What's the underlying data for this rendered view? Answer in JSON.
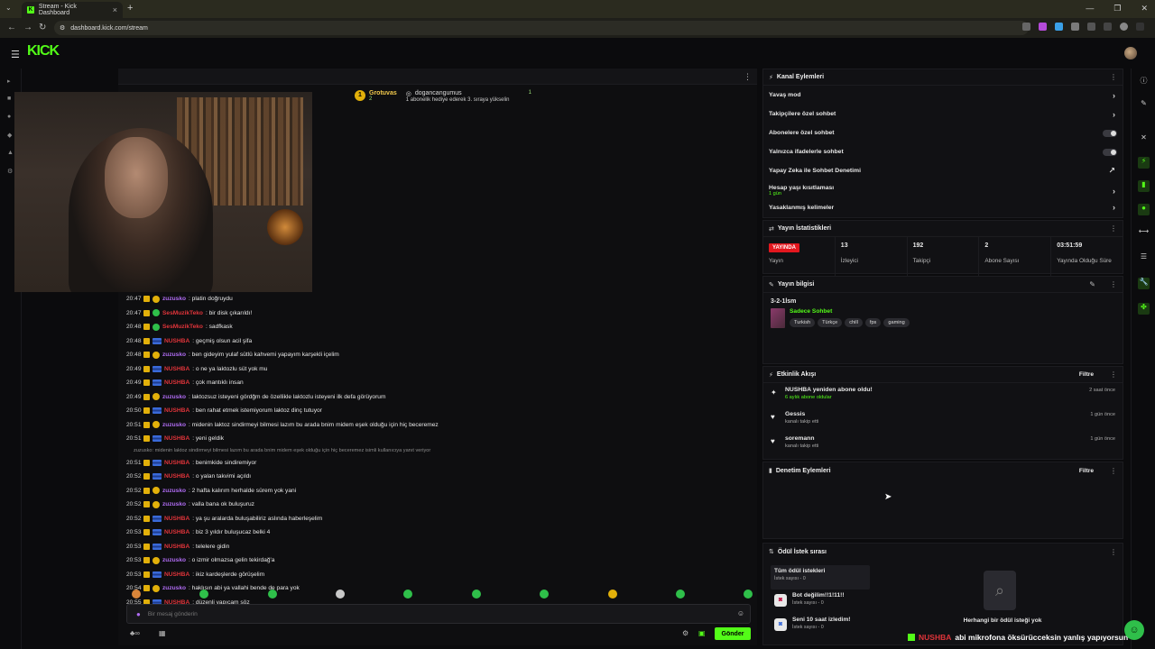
{
  "browser": {
    "tab_title": "Stream - Kick Dashboard",
    "url": "dashboard.kick.com/stream"
  },
  "app": {
    "logo": "KICK"
  },
  "pinned": {
    "gifter_name": "Grotuvas",
    "gifter_count": "2",
    "recipient_name": "dogancangumus",
    "recipient_count": "1",
    "gift_text": "1 abonelik hediye ederek 3. sıraya yükselin"
  },
  "messages": [
    {
      "time": "20:47",
      "user": "zuzusko",
      "color": "purple",
      "text": ": platin doğruydu"
    },
    {
      "time": "20:47",
      "user": "SesMuzikTeko",
      "color": "red",
      "text": ": bir disk çıkarıldı!"
    },
    {
      "time": "20:48",
      "user": "SesMuzikTeko",
      "color": "red",
      "text": ": sadfkask"
    },
    {
      "time": "20:48",
      "user": "NUSHBA",
      "color": "red",
      "text": ": geçmiş olsun acil şifa"
    },
    {
      "time": "20:48",
      "user": "zuzusko",
      "color": "purple",
      "text": ": ben gideyim yulaf sütlü kahvemi yapayım karşekli içelim"
    },
    {
      "time": "20:49",
      "user": "NUSHBA",
      "color": "red",
      "text": ": o ne ya laktozlu süt yok mu"
    },
    {
      "time": "20:49",
      "user": "NUSHBA",
      "color": "red",
      "text": ": çok mantıklı insan"
    },
    {
      "time": "20:49",
      "user": "zuzusko",
      "color": "purple",
      "text": ": laktozsuz isteyeni gördğm de özellikle laktozlu isteyeni ilk defa görüyorum"
    },
    {
      "time": "20:50",
      "user": "NUSHBA",
      "color": "red",
      "text": ": ben rahat etmek istemiyorum laktoz dinç tutuyor"
    },
    {
      "time": "20:51",
      "user": "zuzusko",
      "color": "purple",
      "text": ": midenin laktoz sindirmeyi bilmesi lazım bu arada bnim midem eşek olduğu için hiç beceremez"
    },
    {
      "time": "20:51",
      "user": "NUSHBA",
      "color": "red",
      "text": ": yeni geldik"
    },
    {
      "reply": "zuzusko: midenin laktoz sindirmeyi bilmesi lazım bu arada bnim midem eşek olduğu için hiç beceremez isimli kullanıcıya yanıt veriyor"
    },
    {
      "time": "20:51",
      "user": "NUSHBA",
      "color": "red",
      "text": ": benimkide sindiremiyor"
    },
    {
      "time": "20:52",
      "user": "NUSHBA",
      "color": "red",
      "text": ": o yalan takvimi açıldı"
    },
    {
      "time": "20:52",
      "user": "zuzusko",
      "color": "purple",
      "text": ": 2 hafta kalırım herhalde sürem yok yani"
    },
    {
      "time": "20:52",
      "user": "zuzusko",
      "color": "purple",
      "text": ": valla bana ok buluşuruz"
    },
    {
      "time": "20:52",
      "user": "NUSHBA",
      "color": "red",
      "text": ": ya şu aralarda buluşabiliriz aslında haberleşelim"
    },
    {
      "time": "20:53",
      "user": "NUSHBA",
      "color": "red",
      "text": ": biz 3 yıldır buluşucaz belki 4"
    },
    {
      "time": "20:53",
      "user": "NUSHBA",
      "color": "red",
      "text": ": telelere gidin"
    },
    {
      "time": "20:53",
      "user": "zuzusko",
      "color": "purple",
      "text": ": o izmir olmazsa gelin tekirdağ'a"
    },
    {
      "time": "20:53",
      "user": "NUSHBA",
      "color": "red",
      "text": ": ikiz kardeşlerde görüşelim"
    },
    {
      "time": "20:54",
      "user": "zuzusko",
      "color": "purple",
      "text": ": haklısın abi ya vallahi bende de para yok"
    },
    {
      "time": "20:55",
      "user": "NUSHBA",
      "color": "red",
      "text": ": düzenli yapıcam söz"
    },
    {
      "time": "20:55",
      "user": "NUSHBA",
      "color": "red",
      "text": ": abi mikrofona öksürücceksin yanlış yapıyorsun"
    }
  ],
  "chat_input": {
    "placeholder": "Bir mesaj gönderin",
    "send_label": "Gönder"
  },
  "channel_actions": {
    "title": "Kanal Eylemleri",
    "items": [
      {
        "label": "Yavaş mod"
      },
      {
        "label": "Takipçilere özel sohbet"
      },
      {
        "label": "Abonelere özel sohbet"
      },
      {
        "label": "Yalnızca ifadelerle sohbet"
      },
      {
        "label": "Yapay Zeka ile Sohbet Denetimi"
      },
      {
        "label": "Hesap yaşı kısıtlaması",
        "sub": "1 gün"
      },
      {
        "label": "Yasaklanmış kelimeler"
      }
    ]
  },
  "stream_stats": {
    "title": "Yayın İstatistikleri",
    "live_badge": "YAYINDA",
    "items": [
      {
        "value": "",
        "label": "Yayın"
      },
      {
        "value": "13",
        "label": "İzleyici"
      },
      {
        "value": "192",
        "label": "Takipçi"
      },
      {
        "value": "2",
        "label": "Abone Sayısı"
      },
      {
        "value": "03:51:59",
        "label": "Yayında Olduğu Süre"
      }
    ]
  },
  "stream_info": {
    "title": "Yayın bilgisi",
    "stream_title": "3-2-1lsm",
    "category": "Sadece Sohbet",
    "tags": [
      "Turkish",
      "Türkçe",
      "chill",
      "fps",
      "gaming"
    ]
  },
  "activity": {
    "title": "Etkinlik Akışı",
    "filter_label": "Filtre",
    "events": [
      {
        "name": "NUSHBA yeniden abone oldu!",
        "sub": "6 aylık abone oldular",
        "time": "2 saat önce"
      },
      {
        "name": "Gessis",
        "sub": "kanalı takip etti",
        "time": "1 gün önce"
      },
      {
        "name": "soremann",
        "sub": "kanalı takip etti",
        "time": "1 gün önce"
      }
    ]
  },
  "moderation": {
    "title": "Denetim Eylemleri",
    "filter_label": "Filtre"
  },
  "reward_queue": {
    "title": "Ödül İstek sırası",
    "items": [
      {
        "name": "Tüm ödül istekleri",
        "sub": "İstek sayısı - 0"
      },
      {
        "name": "Bot değilim!!1!11!!",
        "sub": "İstek sayısı - 0"
      },
      {
        "name": "Seni 10 saat izledim!",
        "sub": "İstek sayısı - 0"
      }
    ],
    "empty_title": "Herhangi bir ödül isteği yok"
  },
  "ticker": {
    "name": "NUSHBA",
    "message": "abi mikrofona öksürücceksin yanlış yapıyorsun"
  }
}
